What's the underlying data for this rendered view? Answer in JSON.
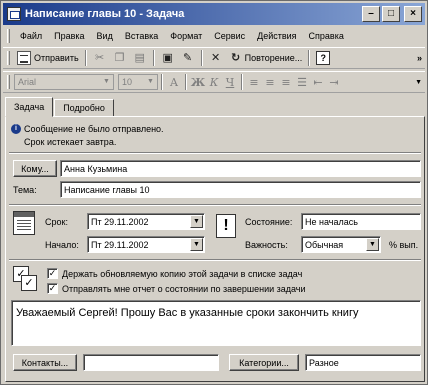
{
  "window": {
    "title": "Написание главы 10 - Задача"
  },
  "menu": [
    "Файл",
    "Правка",
    "Вид",
    "Вставка",
    "Формат",
    "Сервис",
    "Действия",
    "Справка"
  ],
  "toolbar1": {
    "send_label": "Отправить",
    "recurrence_label": "Повторение...",
    "help_glyph": "?"
  },
  "toolbar2": {
    "font_name": "Arial",
    "font_size": "10"
  },
  "tabs": [
    "Задача",
    "Подробно"
  ],
  "info": {
    "line1": "Сообщение не было отправлено.",
    "line2": "Срок истекает завтра."
  },
  "to": {
    "button": "Кому...",
    "value": "Анна Кузьмина"
  },
  "subject": {
    "label": "Тема:",
    "value": "Написание главы 10"
  },
  "due": {
    "label": "Срок:",
    "value": "Пт 29.11.2002"
  },
  "start": {
    "label": "Начало:",
    "value": "Пт 29.11.2002"
  },
  "status": {
    "label": "Состояние:",
    "value": "Не началась"
  },
  "priority": {
    "label": "Важность:",
    "value": "Обычная",
    "percent_label": "% вып."
  },
  "checks": {
    "keep_copy": "Держать обновляемую копию этой задачи в списке задач",
    "send_report": "Отправлять мне отчет о состоянии по завершении задачи"
  },
  "body_text": "Уважаемый Сергей! Прошу Вас в указанные сроки закончить книгу",
  "footer": {
    "contacts_button": "Контакты...",
    "categories_button": "Категории...",
    "categories_value": "Разное"
  }
}
